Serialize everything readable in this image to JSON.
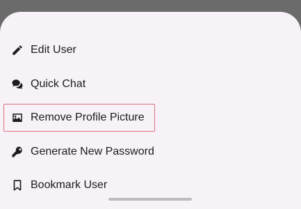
{
  "menu": {
    "items": [
      {
        "label": "Edit User",
        "icon": "pencil-icon"
      },
      {
        "label": "Quick Chat",
        "icon": "chat-bubbles-icon"
      },
      {
        "label": "Remove Profile Picture",
        "icon": "image-icon"
      },
      {
        "label": "Generate New Password",
        "icon": "key-icon"
      },
      {
        "label": "Bookmark User",
        "icon": "bookmark-icon"
      }
    ]
  },
  "colors": {
    "scrim": "#6b6b6b",
    "sheet_background": "#f7f2f8",
    "text": "#1c1b1f",
    "highlight_border": "#d9737b"
  }
}
